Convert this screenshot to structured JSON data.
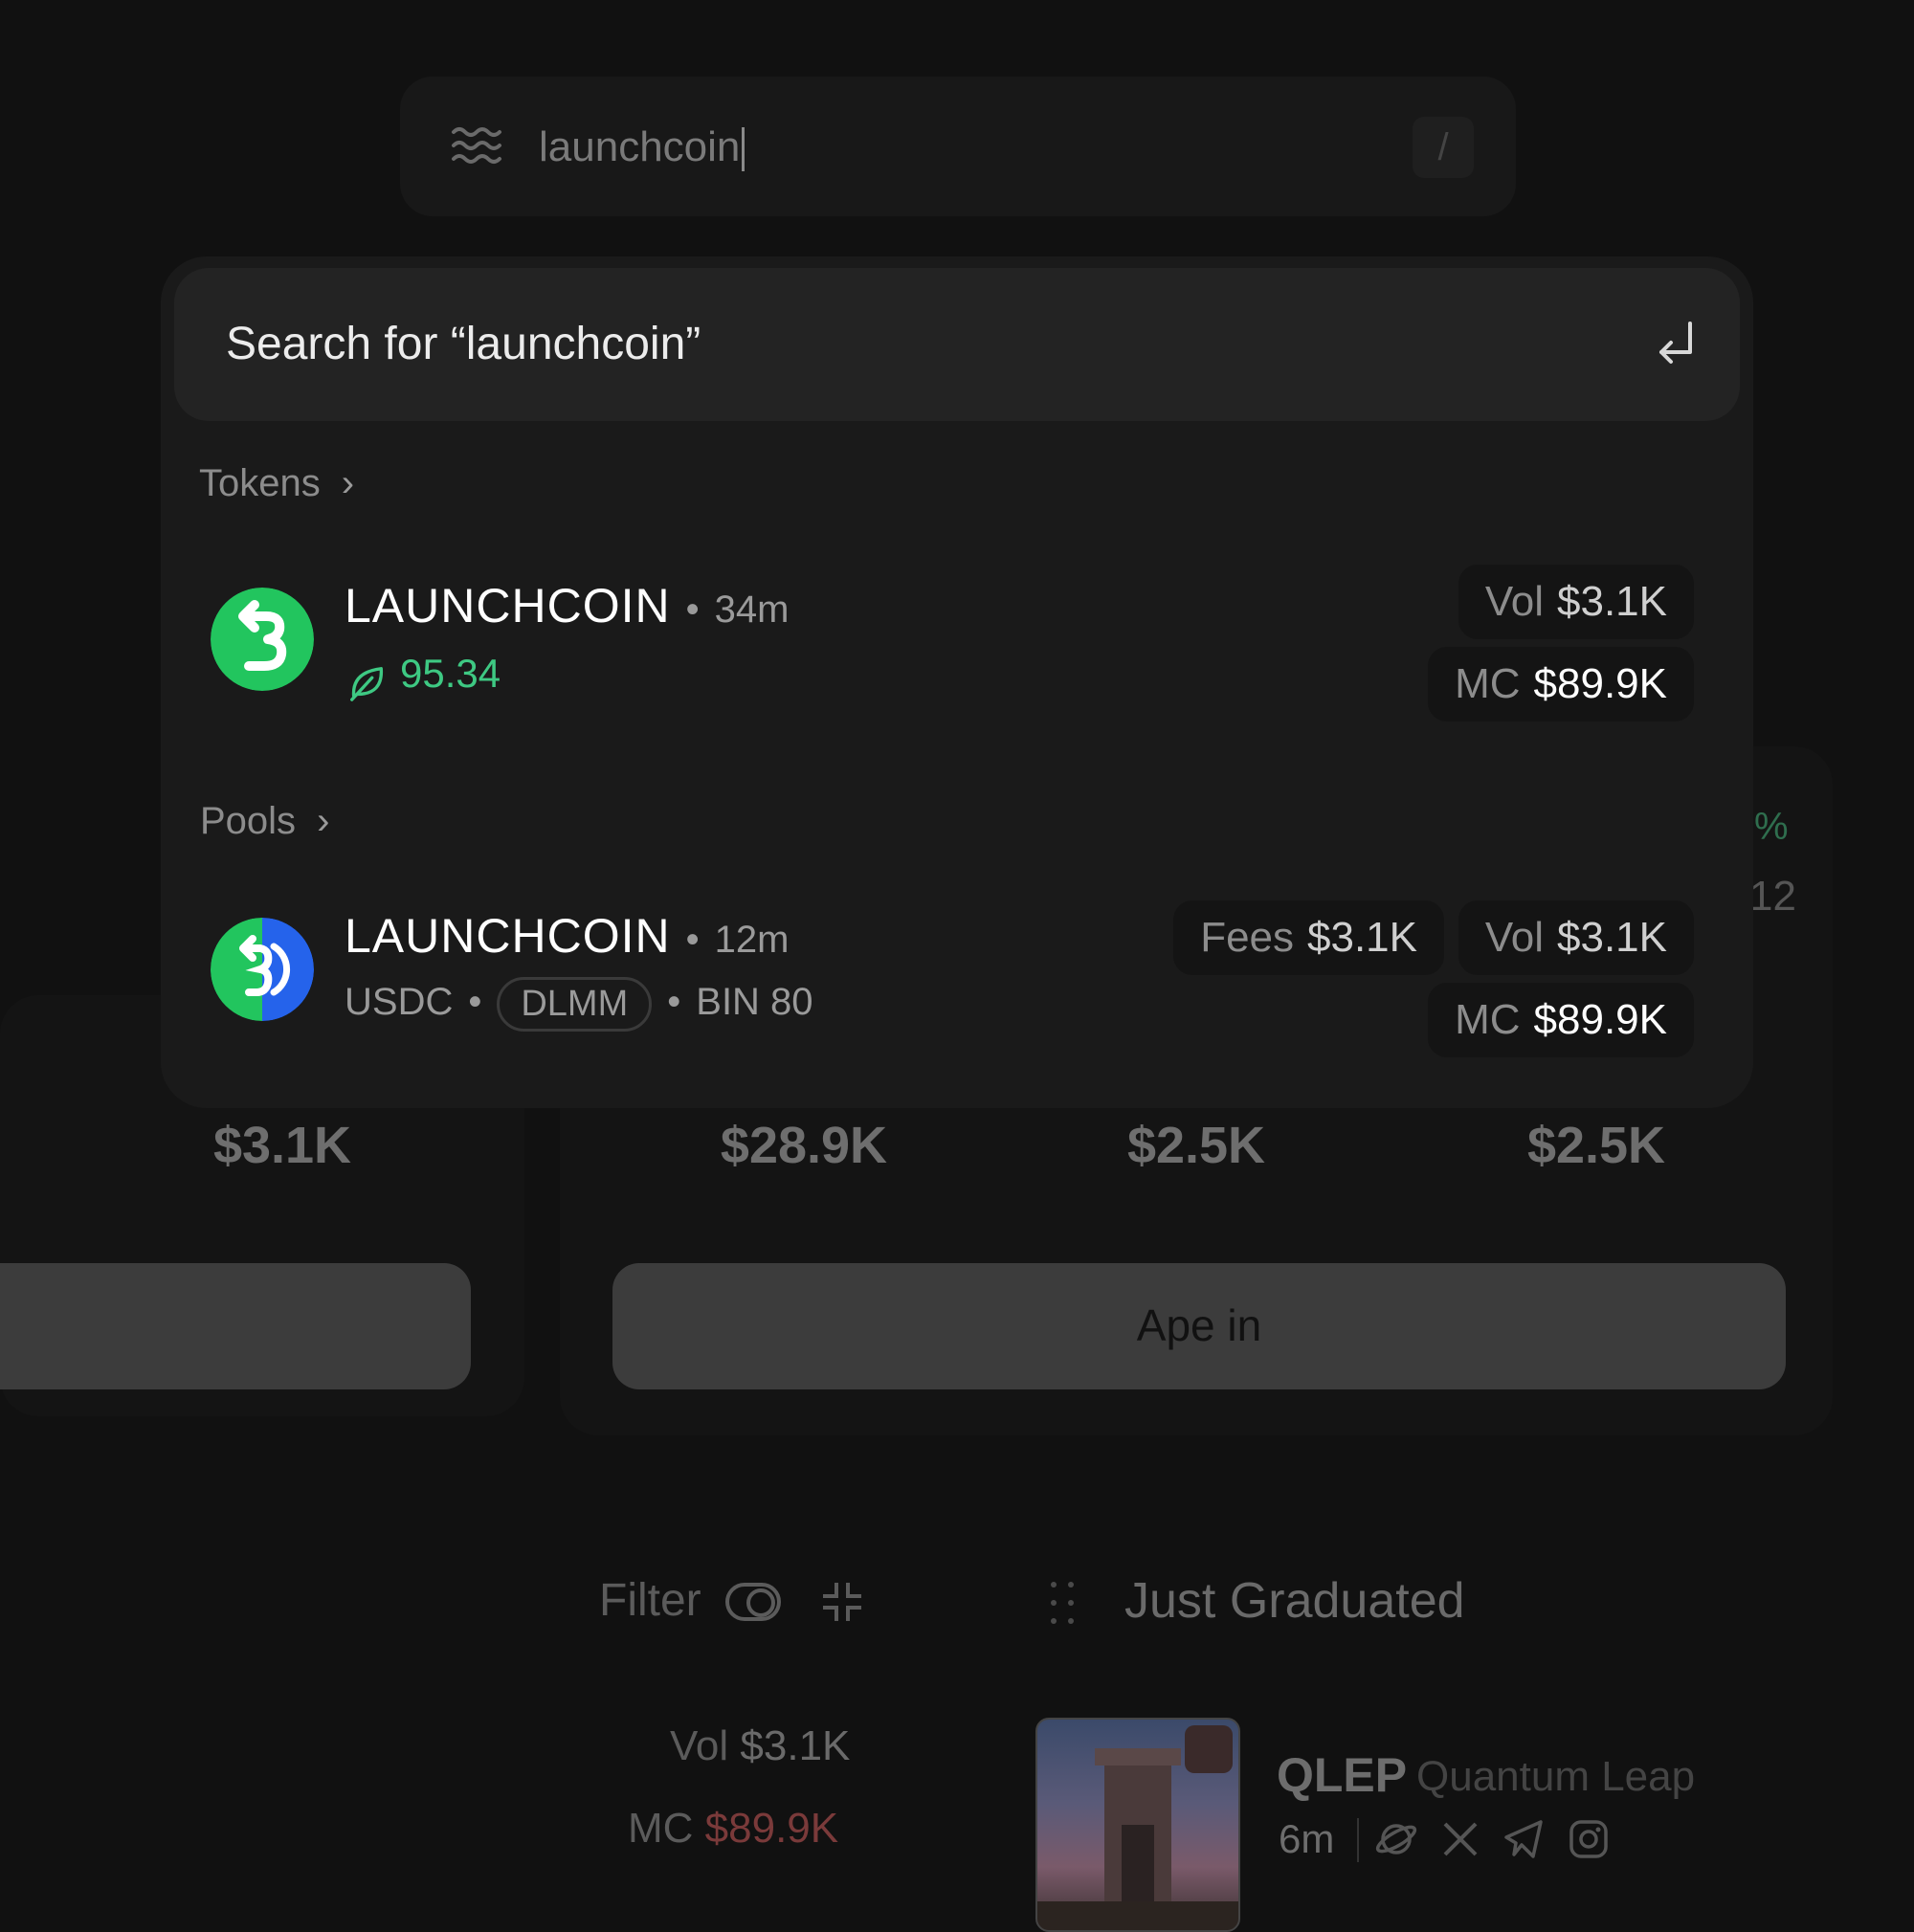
{
  "search_bar": {
    "value": "launchcoin",
    "shortcut_key": "/"
  },
  "dropdown": {
    "search_for_label": "Search for “launchcoin”",
    "tokens_section": {
      "title": "Tokens",
      "chevron": "›"
    },
    "token_item": {
      "name": "LAUNCHCOIN",
      "separator": "•",
      "age": "34m",
      "score": "95.34",
      "vol_label": "Vol",
      "vol_value": "$3.1K",
      "mc_label": "MC",
      "mc_value": "$89.9K"
    },
    "pools_section": {
      "title": "Pools",
      "chevron": "›"
    },
    "pool_item": {
      "name": "LAUNCHCOIN",
      "separator": "•",
      "age": "12m",
      "quote": "USDC",
      "type_badge": "DLMM",
      "bin": "BIN 80",
      "fees_label": "Fees",
      "fees_value": "$3.1K",
      "vol_label": "Vol",
      "vol_value": "$3.1K",
      "mc_label": "MC",
      "mc_value": "$89.9K"
    }
  },
  "background": {
    "stats": [
      "$3.1K",
      "$28.9K",
      "$2.5K",
      "$2.5K"
    ],
    "peek_percent": "%",
    "peek_number": "12",
    "ape_in_label": "Ape in",
    "filter_label": "Filter",
    "list_title": "Just Graduated",
    "left_vol_label": "Vol",
    "left_vol_value": "$3.1K",
    "left_mc_label": "MC",
    "left_mc_value": "$89.9K",
    "qlep": {
      "symbol": "QLEP",
      "name": "Quantum Leap",
      "age": "6m"
    }
  },
  "colors": {
    "accent_green": "#3ec983",
    "panel_bg": "#1a1a1a",
    "page_bg": "#111111",
    "negative_red": "#7a3a3a"
  },
  "icons": [
    "waves-icon",
    "enter-icon",
    "chevron-right-icon",
    "leaf-icon",
    "toggle-icon",
    "compress-icon",
    "drag-handle-icon",
    "globe-icon",
    "x-icon",
    "telegram-icon",
    "instagram-icon"
  ]
}
